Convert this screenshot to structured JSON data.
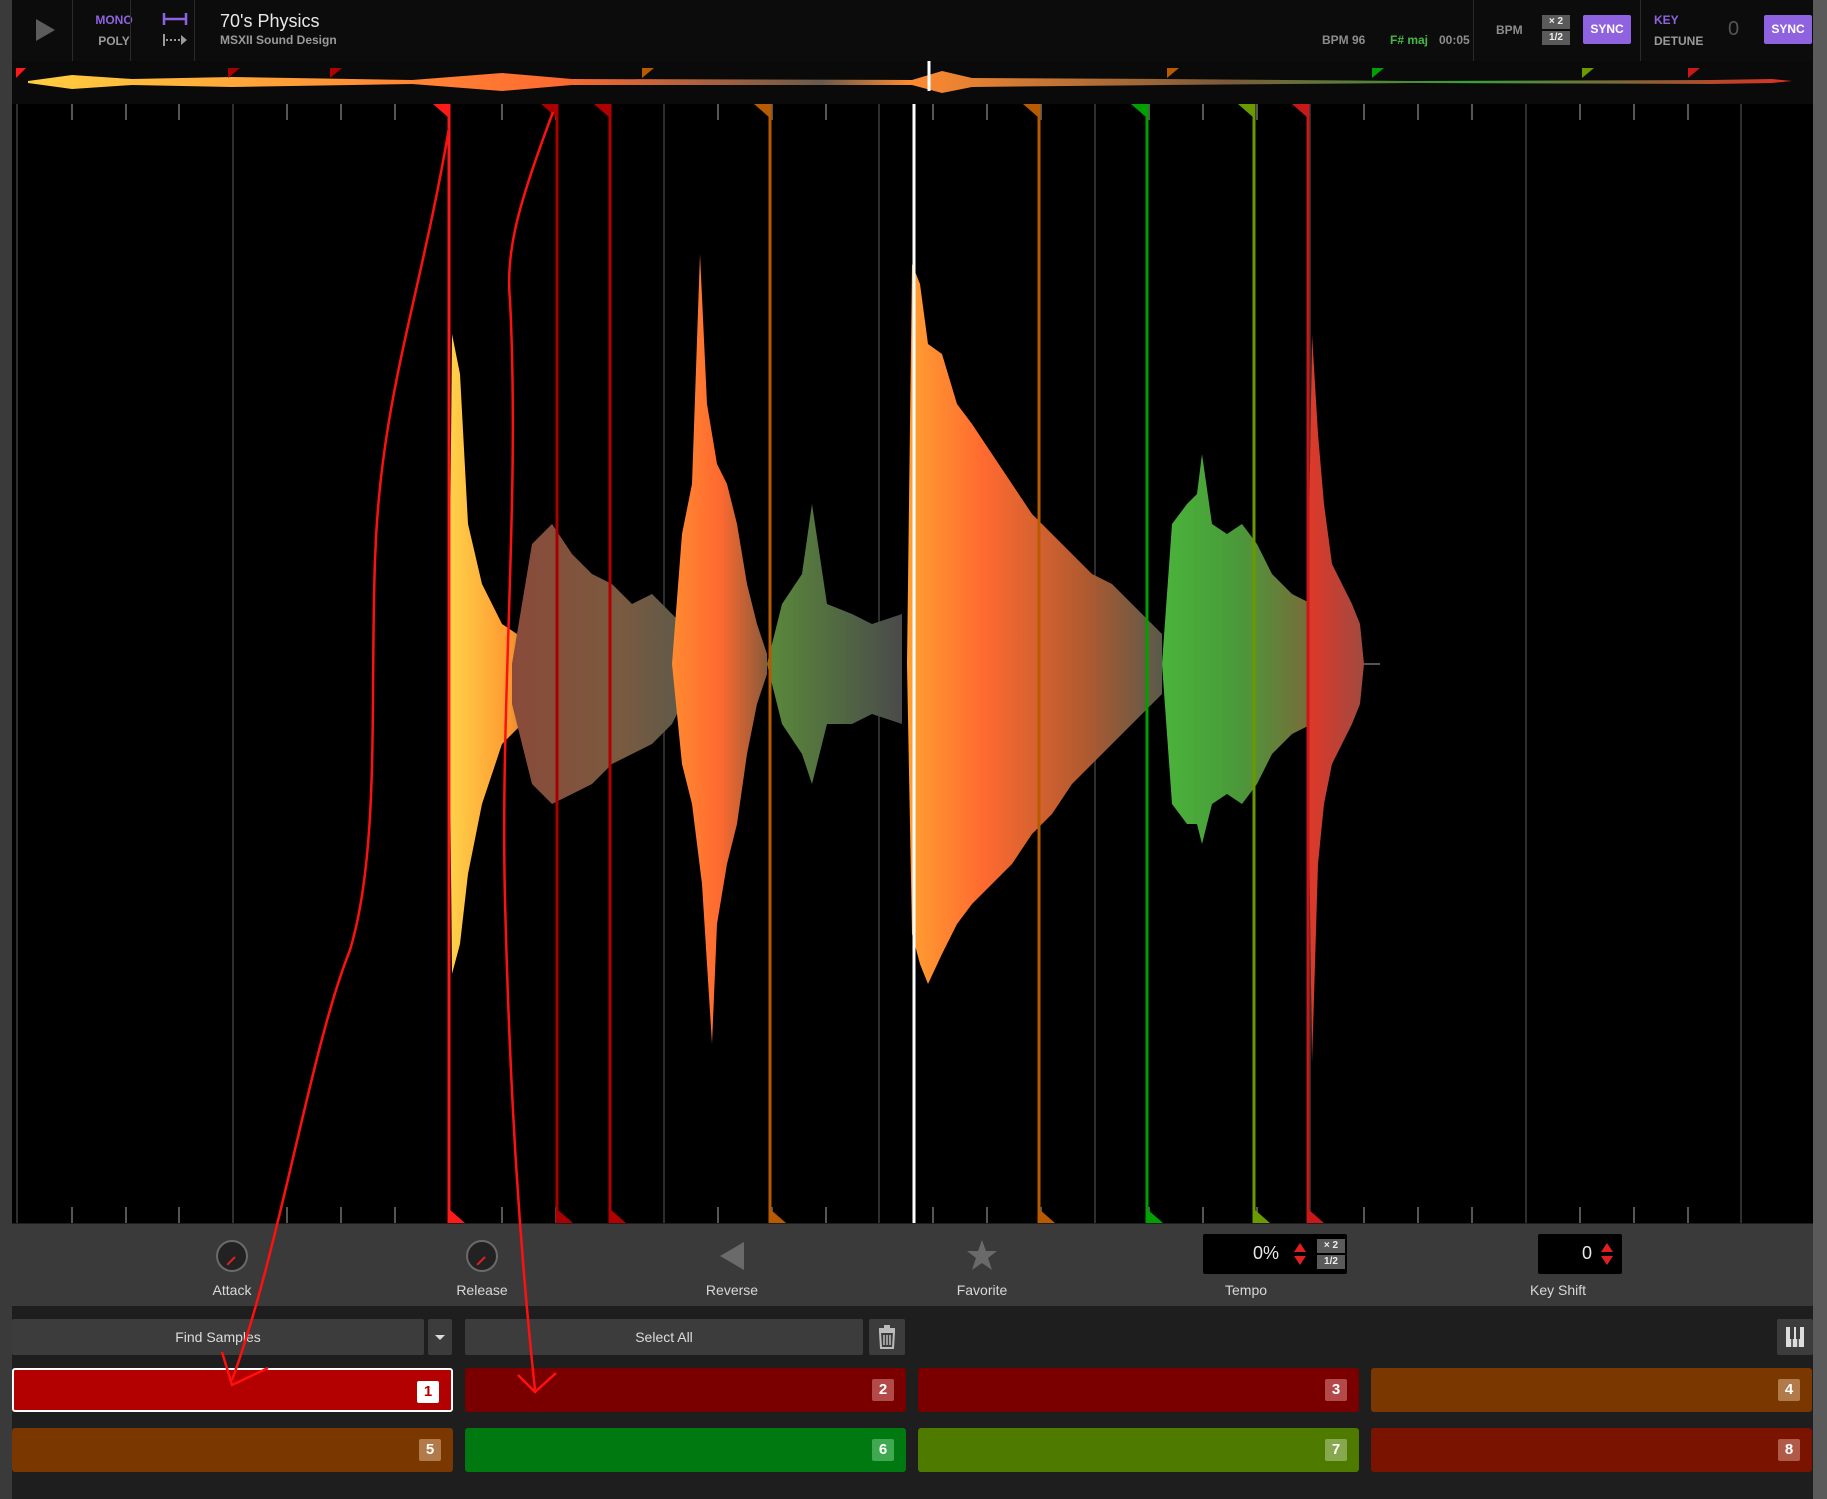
{
  "track": {
    "title": "70's Physics",
    "artist": "MSXII Sound Design"
  },
  "mode": {
    "mono_label": "MONO",
    "poly_label": "POLY",
    "active": "MONO"
  },
  "info": {
    "bpm": "BPM 96",
    "key": "F# maj",
    "time": "00:05"
  },
  "bpm_section": {
    "label": "BPM",
    "double": "× 2",
    "half": "1/2",
    "sync": "SYNC"
  },
  "key_section": {
    "label": "KEY",
    "detune_label": "DETUNE",
    "detune_value": "0",
    "sync": "SYNC"
  },
  "controls": {
    "attack": "Attack",
    "release": "Release",
    "reverse": "Reverse",
    "favorite": "Favorite",
    "tempo_label": "Tempo",
    "tempo_value": "0%",
    "tempo_double": "× 2",
    "tempo_half": "1/2",
    "keyshift_label": "Key Shift",
    "keyshift_value": "0"
  },
  "toolbar": {
    "find_samples": "Find Samples",
    "select_all": "Select All"
  },
  "pads": [
    {
      "num": "1",
      "color": "#b30000",
      "badge": "#ffffff",
      "selected": true
    },
    {
      "num": "2",
      "color": "#7a0000",
      "badge": "#b34a4a"
    },
    {
      "num": "3",
      "color": "#7a0000",
      "badge": "#b34a4a"
    },
    {
      "num": "4",
      "color": "#7a3800",
      "badge": "#b07a4a"
    },
    {
      "num": "5",
      "color": "#7a3800",
      "badge": "#b07a4a"
    },
    {
      "num": "6",
      "color": "#007a10",
      "badge": "#40a850"
    },
    {
      "num": "7",
      "color": "#4e7a00",
      "badge": "#88a850"
    },
    {
      "num": "8",
      "color": "#7a1400",
      "badge": "#b05a4a"
    }
  ],
  "markers": [
    {
      "color": "#ff1a1a"
    },
    {
      "color": "#a80000"
    },
    {
      "color": "#b00000"
    },
    {
      "color": "#b85a00"
    },
    {
      "color": "#b85a00"
    },
    {
      "color": "#00a000"
    },
    {
      "color": "#6a9a00"
    },
    {
      "color": "#c81818"
    }
  ],
  "colors": {
    "accent": "#8f63e0",
    "key_text": "#46b846"
  }
}
